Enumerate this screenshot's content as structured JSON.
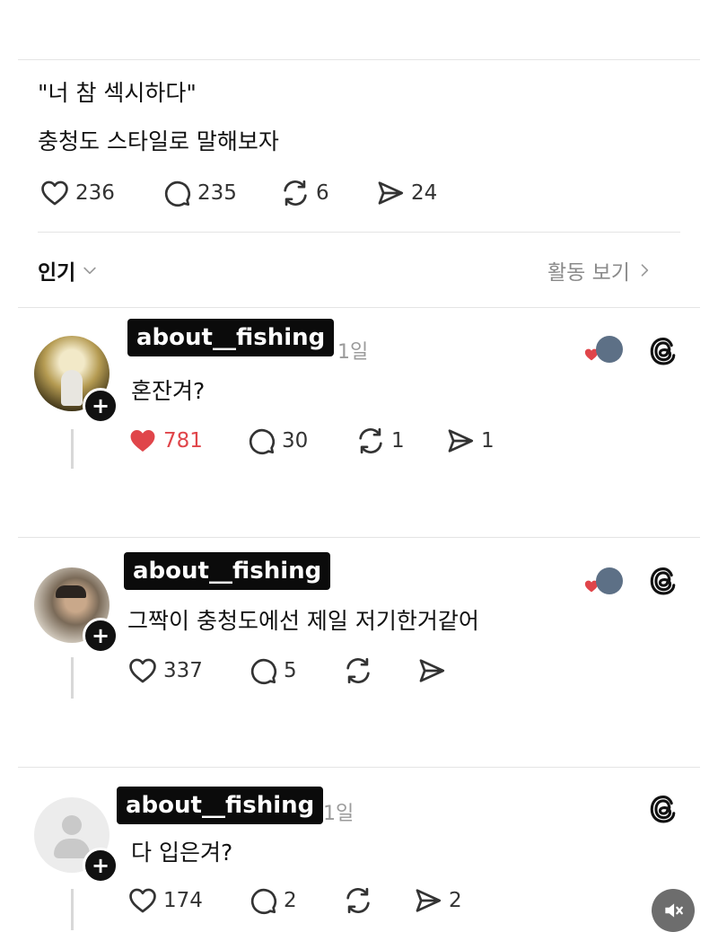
{
  "post": {
    "line1": "\"너 참 섹시하다\"",
    "line2": "충청도 스타일로 말해보자",
    "stats": {
      "likes": "236",
      "replies": "235",
      "reposts": "6",
      "shares": "24"
    }
  },
  "sort_bar": {
    "sort_label": "인기",
    "activity_label": "활동 보기"
  },
  "comments": [
    {
      "username": "about__fishing",
      "time": "1일",
      "text": "혼잔겨?",
      "stats": {
        "likes": "781",
        "replies": "30",
        "reposts": "1",
        "shares": "1"
      },
      "liked": true
    },
    {
      "username": "about__fishing",
      "time": "",
      "text": "그짝이 충청도에선 제일 저기한거같어",
      "stats": {
        "likes": "337",
        "replies": "5",
        "reposts": "",
        "shares": ""
      },
      "liked": false
    },
    {
      "username": "about__fishing",
      "time": "1일",
      "text": "다 입은겨?",
      "stats": {
        "likes": "174",
        "replies": "2",
        "reposts": "",
        "shares": "2"
      },
      "liked": false
    }
  ],
  "colors": {
    "like_red": "#e0454a",
    "username_bg": "#0b0b0b",
    "muted": "#8a8a8a"
  },
  "icons": [
    "heart-icon",
    "reply-icon",
    "repost-icon",
    "share-icon",
    "threads-logo-icon",
    "plus-icon",
    "chevron-down-icon",
    "chevron-right-icon",
    "mute-icon"
  ]
}
